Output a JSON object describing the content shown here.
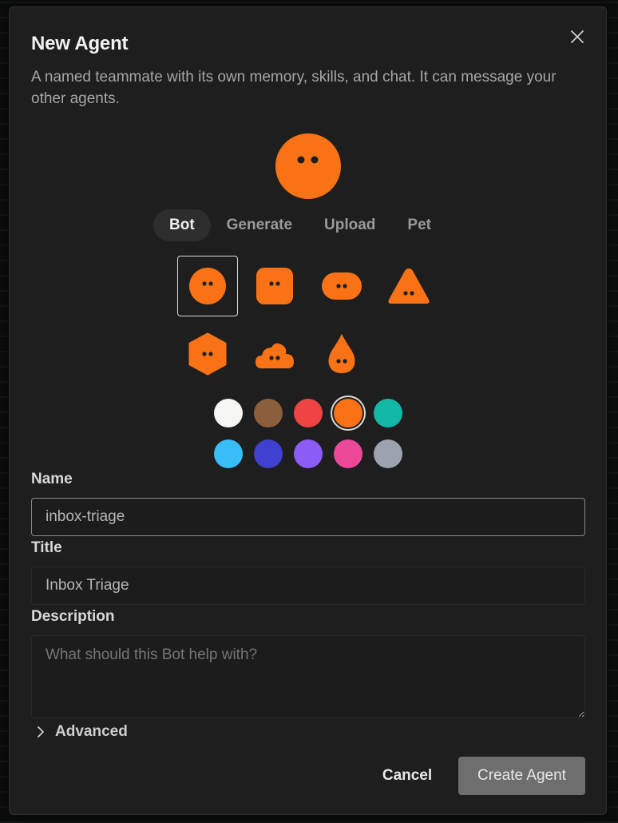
{
  "dialog": {
    "title": "New Agent",
    "subtitle": "A named teammate with its own memory, skills, and chat. It can message your other agents."
  },
  "avatar": {
    "color": "#f97316",
    "shape": "circle-bot-icon",
    "tabs": [
      {
        "label": "Bot",
        "active": true
      },
      {
        "label": "Generate",
        "active": false
      },
      {
        "label": "Upload",
        "active": false
      },
      {
        "label": "Pet",
        "active": false
      }
    ],
    "shapes": [
      {
        "name": "circle-bot-icon",
        "selected": true
      },
      {
        "name": "rounded-square-bot-icon",
        "selected": false
      },
      {
        "name": "pill-bot-icon",
        "selected": false
      },
      {
        "name": "triangle-bot-icon",
        "selected": false
      },
      {
        "name": "hexagon-bot-icon",
        "selected": false
      },
      {
        "name": "cloud-bot-icon",
        "selected": false
      },
      {
        "name": "droplet-bot-icon",
        "selected": false
      }
    ],
    "colors": [
      {
        "hex": "#f5f5f4",
        "selected": false
      },
      {
        "hex": "#8b5e3c",
        "selected": false
      },
      {
        "hex": "#ef4444",
        "selected": false
      },
      {
        "hex": "#f97316",
        "selected": true
      },
      {
        "hex": "#14b8a6",
        "selected": false
      },
      {
        "hex": "#38bdf8",
        "selected": false
      },
      {
        "hex": "#4040d0",
        "selected": false
      },
      {
        "hex": "#8b5cf6",
        "selected": false
      },
      {
        "hex": "#ec4899",
        "selected": false
      },
      {
        "hex": "#9ca3af",
        "selected": false
      }
    ]
  },
  "form": {
    "name_label": "Name",
    "name_value": "inbox-triage",
    "title_label": "Title",
    "title_value": "Inbox Triage",
    "description_label": "Description",
    "description_placeholder": "What should this Bot help with?",
    "advanced_label": "Advanced"
  },
  "actions": {
    "cancel_label": "Cancel",
    "create_label": "Create Agent"
  }
}
